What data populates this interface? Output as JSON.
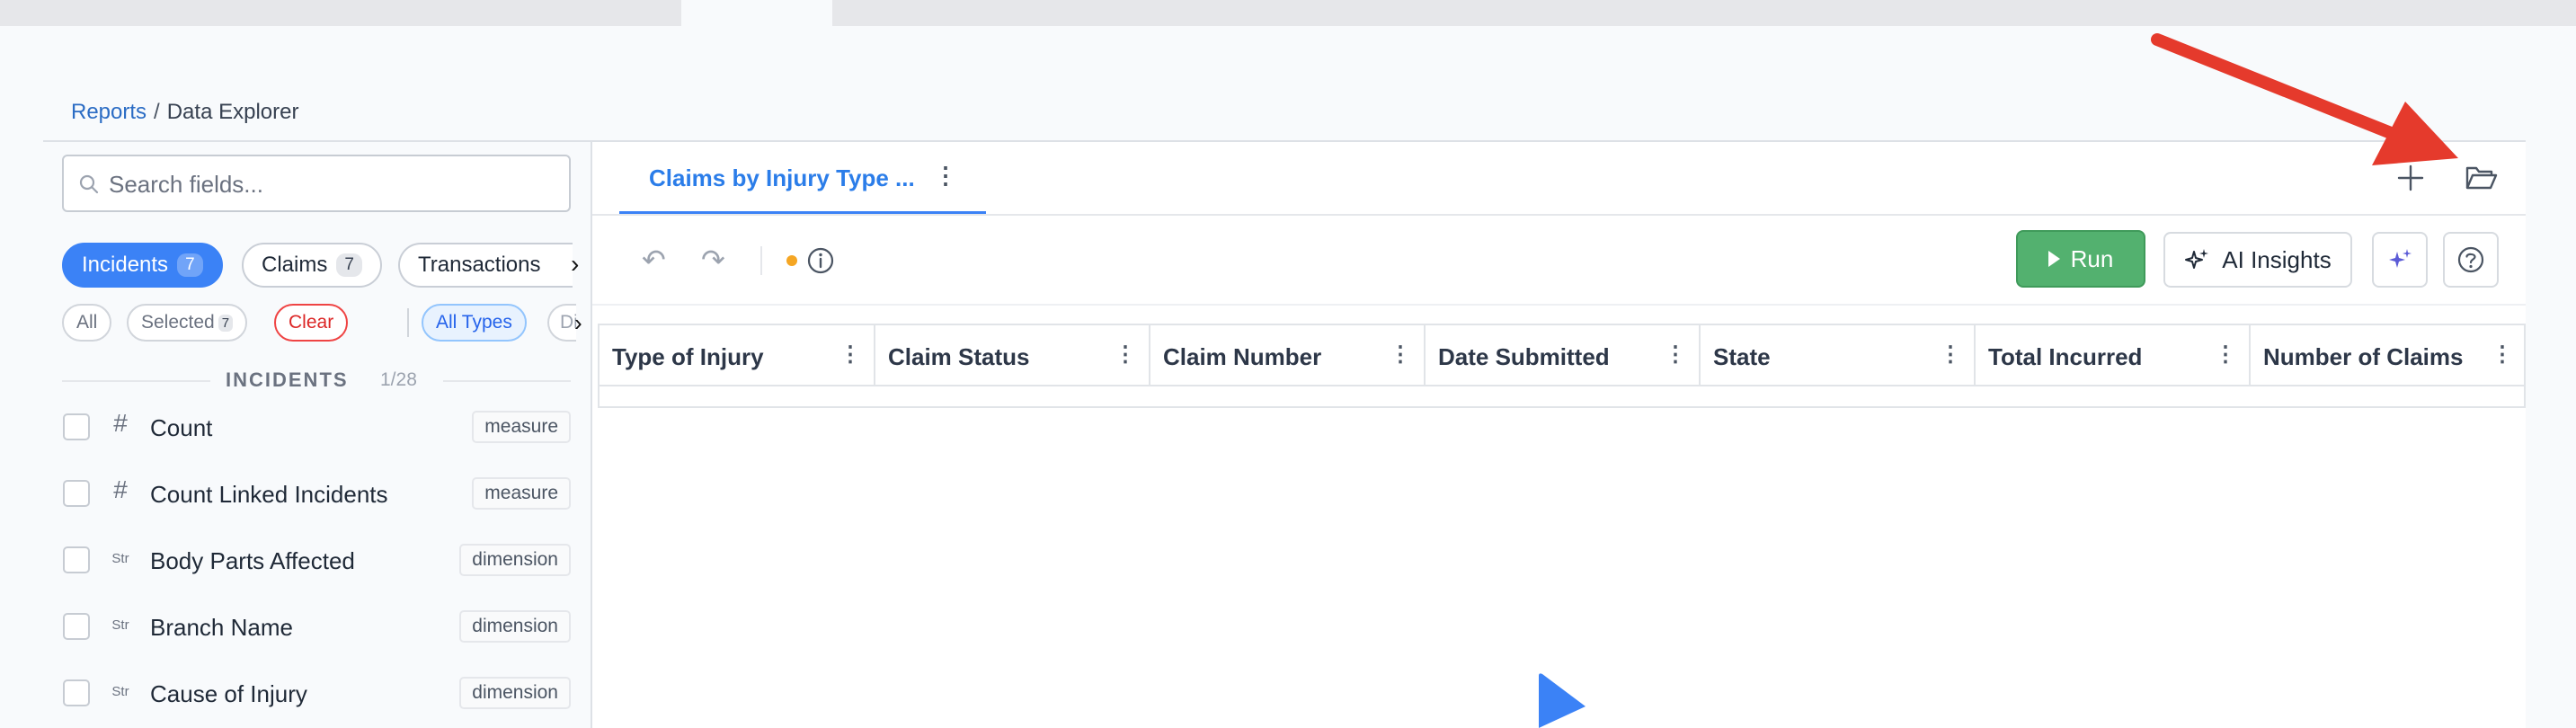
{
  "breadcrumb": {
    "root": "Reports",
    "separator": "/",
    "current": "Data Explorer"
  },
  "sidebar": {
    "search_placeholder": "Search fields...",
    "tabs": [
      {
        "label": "Incidents",
        "count": "7"
      },
      {
        "label": "Claims",
        "count": "7"
      },
      {
        "label": "Transactions",
        "count": ""
      }
    ],
    "filters": {
      "all": "All",
      "selected": "Selected",
      "selected_count": "7",
      "clear": "Clear",
      "all_types": "All Types",
      "dimensions": "Dim"
    },
    "section": {
      "title": "INCIDENTS",
      "count": "1/28"
    },
    "fields": [
      {
        "type": "#",
        "name": "Count",
        "tag": "measure"
      },
      {
        "type": "#",
        "name": "Count Linked Incidents",
        "tag": "measure"
      },
      {
        "type": "Str",
        "name": "Body Parts Affected",
        "tag": "dimension"
      },
      {
        "type": "Str",
        "name": "Branch Name",
        "tag": "dimension"
      },
      {
        "type": "Str",
        "name": "Cause of Injury",
        "tag": "dimension"
      }
    ]
  },
  "main": {
    "active_tab": "Claims by Injury Type ...",
    "toolbar": {
      "run_label": "Run",
      "ai_label": "AI Insights"
    },
    "columns": [
      "Type of Injury",
      "Claim Status",
      "Claim Number",
      "Date Submitted",
      "State",
      "Total Incurred",
      "Number of Claims"
    ]
  },
  "colors": {
    "accent": "#3b82f6",
    "run_green": "#53b16f",
    "annotation_arrow": "#e53a2c",
    "cursor": "#3b82f6"
  }
}
